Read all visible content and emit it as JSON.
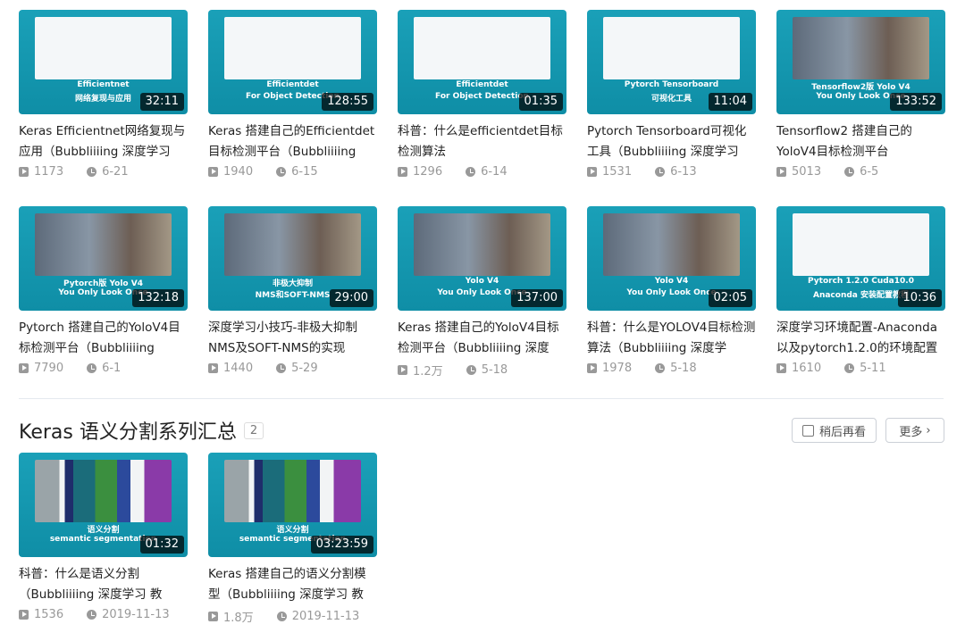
{
  "row1": [
    {
      "cap1": "Efficientnet",
      "cap2": "网络复现与应用",
      "duration": "32:11",
      "title": "Keras Efficientnet网络复现与应用（Bubbliiiing 深度学习",
      "views": "1173",
      "date": "6-21",
      "panel": "diagram"
    },
    {
      "cap1": "Efficientdet",
      "cap2": "For Object Detection",
      "duration": "128:55",
      "title": "Keras 搭建自己的Efficientdet目标检测平台（Bubbliiiing",
      "views": "1940",
      "date": "6-15",
      "panel": "diagram"
    },
    {
      "cap1": "Efficientdet",
      "cap2": "For Object Detection",
      "duration": "01:35",
      "title": "科普：什么是efficientdet目标检测算法",
      "views": "1296",
      "date": "6-14",
      "panel": "diagram"
    },
    {
      "cap1": "Pytorch Tensorboard",
      "cap2": "可视化工具",
      "duration": "11:04",
      "title": "Pytorch Tensorboard可视化工具（Bubbliiiing 深度学习",
      "views": "1531",
      "date": "6-13",
      "panel": "diagram"
    },
    {
      "cap1": "Tensorflow2版  Yolo V4",
      "cap2": "You Only Look Once",
      "duration": "133:52",
      "title": "Tensorflow2 搭建自己的YoloV4目标检测平台",
      "views": "5013",
      "date": "6-5",
      "panel": "photo"
    }
  ],
  "row2": [
    {
      "cap1": "Pytorch版 Yolo V4",
      "cap2": "You Only Look Once",
      "duration": "132:18",
      "title": "Pytorch 搭建自己的YoloV4目标检测平台（Bubbliiiing",
      "views": "7790",
      "date": "6-1",
      "panel": "photo"
    },
    {
      "cap1": "非极大抑制",
      "cap2": "NMS和SOFT-NMS",
      "duration": "29:00",
      "title": "深度学习小技巧-非极大抑制NMS及SOFT-NMS的实现",
      "views": "1440",
      "date": "5-29",
      "panel": "photo"
    },
    {
      "cap1": "Yolo V4",
      "cap2": "You Only Look Once",
      "duration": "137:00",
      "title": "Keras 搭建自己的YoloV4目标检测平台（Bubbliiiing 深度",
      "views": "1.2万",
      "date": "5-18",
      "panel": "photo"
    },
    {
      "cap1": "Yolo V4",
      "cap2": "You Only Look Once",
      "duration": "02:05",
      "title": "科普：什么是YOLOV4目标检测算法（Bubbliiiing 深度学",
      "views": "1978",
      "date": "5-18",
      "panel": "photo"
    },
    {
      "cap1": "Pytorch 1.2.0 Cuda10.0",
      "cap2": "Anaconda 安装配置教程",
      "duration": "10:36",
      "title": "深度学习环境配置-Anaconda以及pytorch1.2.0的环境配置",
      "views": "1610",
      "date": "5-11",
      "panel": "diagram"
    }
  ],
  "section": {
    "title": "Keras 语义分割系列汇总",
    "count": "2",
    "watch_later": "稍后再看",
    "more": "更多"
  },
  "row3": [
    {
      "cap1": "语义分割",
      "cap2": "semantic segmentation",
      "duration": "01:32",
      "title": "科普：什么是语义分割（Bubbliiiing 深度学习 教",
      "views": "1536",
      "date": "2019-11-13",
      "panel": "seg"
    },
    {
      "cap1": "语义分割",
      "cap2": "semantic segmentation",
      "duration": "03:23:59",
      "title": "Keras 搭建自己的语义分割模型（Bubbliiiing 深度学习 教",
      "views": "1.8万",
      "date": "2019-11-13",
      "panel": "seg"
    }
  ]
}
